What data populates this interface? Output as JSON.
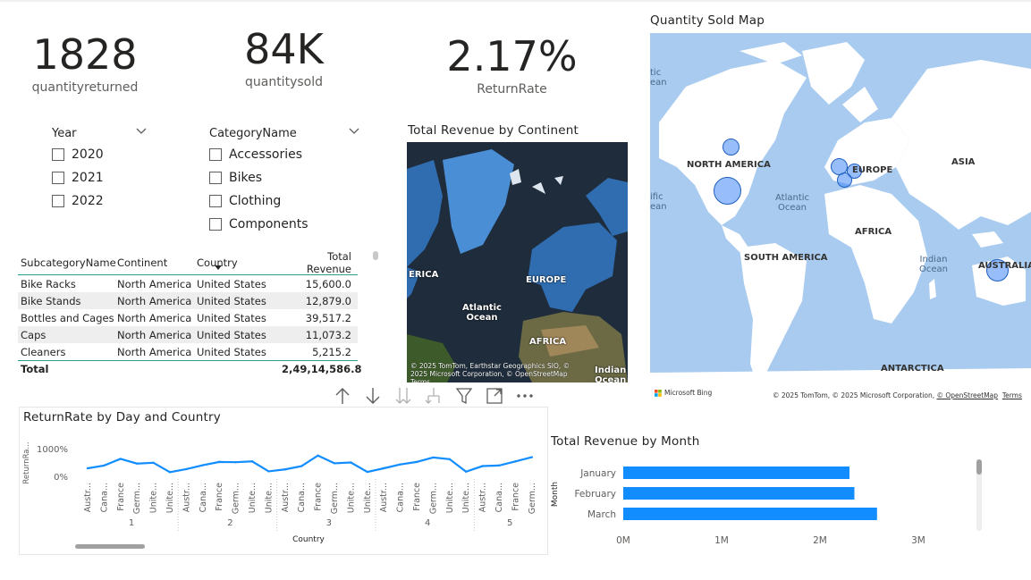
{
  "kpis": [
    {
      "value": "1828",
      "label": "quantityreturned"
    },
    {
      "value": "84K",
      "label": "quantitysold"
    },
    {
      "value": "2.17%",
      "label": "ReturnRate"
    }
  ],
  "slicers": {
    "year": {
      "title": "Year",
      "options": [
        "2020",
        "2021",
        "2022"
      ]
    },
    "category": {
      "title": "CategoryName",
      "options": [
        "Accessories",
        "Bikes",
        "Clothing",
        "Components"
      ]
    }
  },
  "table": {
    "columns": [
      "SubcategoryName",
      "Continent",
      "Country",
      "Total Revenue"
    ],
    "rows": [
      [
        "Bike Racks",
        "North America",
        "United States",
        "15,600.0"
      ],
      [
        "Bike Stands",
        "North America",
        "United States",
        "12,879.0"
      ],
      [
        "Bottles and Cages",
        "North America",
        "United States",
        "39,517.2"
      ],
      [
        "Caps",
        "North America",
        "United States",
        "11,073.2"
      ],
      [
        "Cleaners",
        "North America",
        "United States",
        "5,215.2"
      ]
    ],
    "total_label": "Total",
    "total_value": "2,49,14,586.8"
  },
  "continent_map": {
    "title": "Total Revenue by Continent",
    "labels": {
      "europe": "EUROPE",
      "america_partial": "ERICA",
      "atlantic": "Atlantic\nOcean",
      "africa": "AFRICA",
      "indian": "Indian\nOcean"
    },
    "attribution": "© 2025 TomTom, Earthstar Geographics SIO, © 2025 Microsoft Corporation, © OpenStreetMap  Terms"
  },
  "quantity_map": {
    "title": "Quantity Sold Map",
    "labels": {
      "north_america": "NORTH AMERICA",
      "europe": "EUROPE",
      "asia": "ASIA",
      "africa": "AFRICA",
      "south_america": "SOUTH AMERICA",
      "australia": "AUSTRALIA",
      "antarctica": "ANTARCTICA",
      "atlantic": "Atlantic\nOcean",
      "indian": "Indian\nOcean",
      "pacific_left": "ific\nean",
      "arctic_left": "tic\nean"
    },
    "brand": "Microsoft Bing",
    "attribution": "© 2025 TomTom, © 2025 Microsoft Corporation,",
    "osm": "© OpenStreetMap",
    "terms": "Terms"
  },
  "toolbar": {
    "icons": [
      "arrow-up-icon",
      "arrow-down-icon",
      "double-arrow-down-icon",
      "expand-hierarchy-icon",
      "filter-icon",
      "focus-mode-icon",
      "more-options-icon"
    ]
  },
  "returnrate_chart": {
    "title": "ReturnRate by Day and Country",
    "ylabel": "ReturnRa...",
    "xlabel": "Country",
    "yticks": [
      "1000%",
      "0%"
    ],
    "day_labels": [
      "1",
      "2",
      "3",
      "4",
      "5"
    ],
    "country_labels": [
      "Austr...",
      "Cana...",
      "France",
      "Germ...",
      "Unite...",
      "Unite..."
    ]
  },
  "chart_data": [
    {
      "type": "line",
      "title": "ReturnRate by Day and Country",
      "xlabel": "Country",
      "ylabel": "ReturnRa...",
      "ylim": [
        0,
        1000
      ],
      "groups": [
        "1",
        "2",
        "3",
        "4",
        "5"
      ],
      "categories_per_group": [
        "Austr...",
        "Cana...",
        "France",
        "Germ...",
        "Unite...",
        "Unite..."
      ],
      "values": [
        290,
        390,
        630,
        460,
        490,
        150,
        260,
        400,
        520,
        510,
        540,
        180,
        250,
        370,
        750,
        470,
        500,
        160,
        290,
        430,
        520,
        680,
        620,
        170,
        370,
        390,
        540,
        690
      ],
      "grid": false
    },
    {
      "type": "bar",
      "orientation": "horizontal",
      "title": "Total Revenue by Month",
      "ylabel": "Month",
      "categories": [
        "January",
        "February",
        "March"
      ],
      "values": [
        2300000,
        2350000,
        2580000
      ],
      "xticks": [
        "0M",
        "1M",
        "2M",
        "3M"
      ],
      "xlim": [
        0,
        3000000
      ],
      "color": "#118DFF"
    }
  ],
  "colors": {
    "accent": "#118DFF",
    "teal": "#2a9d8f",
    "ocean_map": "#a9cbef",
    "land_map": "#ffffff"
  }
}
